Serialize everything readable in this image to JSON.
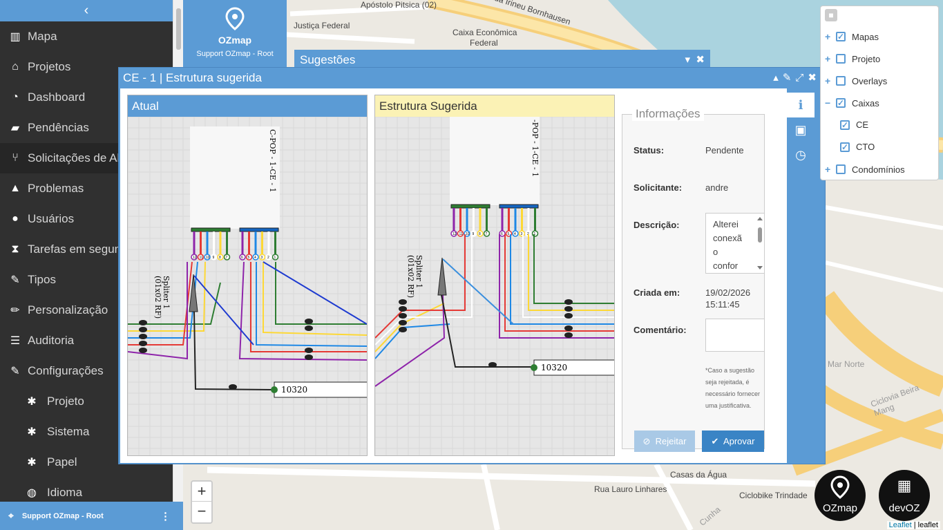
{
  "sidebar": {
    "collapse_icon": "chevron-left-icon",
    "items": [
      {
        "label": "Mapa",
        "icon": "map-icon"
      },
      {
        "label": "Projetos",
        "icon": "home-icon"
      },
      {
        "label": "Dashboard",
        "icon": "pie-chart-icon"
      },
      {
        "label": "Pendências",
        "icon": "truck-icon"
      },
      {
        "label": "Solicitações de Alt",
        "icon": "merge-icon"
      },
      {
        "label": "Problemas",
        "icon": "warning-icon"
      },
      {
        "label": "Usuários",
        "icon": "user-icon"
      },
      {
        "label": "Tarefas em segund",
        "icon": "hourglass-icon"
      },
      {
        "label": "Tipos",
        "icon": "wrench-icon"
      },
      {
        "label": "Personalização",
        "icon": "pencil-icon"
      },
      {
        "label": "Auditoria",
        "icon": "list-icon"
      },
      {
        "label": "Configurações",
        "icon": "wrench-icon"
      }
    ],
    "subitems": [
      {
        "label": "Projeto",
        "icon": "gear-icon"
      },
      {
        "label": "Sistema",
        "icon": "gear-icon"
      },
      {
        "label": "Papel",
        "icon": "gear-icon"
      },
      {
        "label": "Idioma",
        "icon": "globe-icon"
      }
    ],
    "user": "Support OZmap - Root"
  },
  "brand": {
    "logo_text": "OZmap",
    "user": "Support OZmap - Root"
  },
  "map_labels": [
    "Apóstolo Pitsica (02)",
    "Justiça Federal",
    "Caixa Econômica",
    "Federal",
    "Rua Irineu Bornhausen",
    "Mar Norte",
    "Ciclovia Beira Mang",
    "Casas da Água",
    "Rua Lauro Linhares",
    "Ciclobike Trindade",
    "Cunha"
  ],
  "sugestoes": {
    "title": "Sugestões"
  },
  "modal": {
    "title": "CE - 1 | Estrutura sugerida",
    "panel_atual": "Atual",
    "panel_sugerida": "Estrutura Sugerida",
    "box_label": "C-POP - 1-CE - 1",
    "box_label_cut": "-POP - 1-CE - 1",
    "splitter": "Spliter 1",
    "splitter_ratio": "(01x02 RF)",
    "cable_id": "10320",
    "ports_left": [
      "12",
      "11",
      "10",
      "9",
      "8",
      "7"
    ],
    "ports_right": [
      "6",
      "5",
      "4",
      "3",
      "2",
      "1"
    ]
  },
  "info": {
    "legend": "Informações",
    "status_label": "Status:",
    "status_value": "Pendente",
    "requester_label": "Solicitante:",
    "requester_value": "andre",
    "description_label": "Descrição:",
    "description_lines": [
      "Alterei",
      "conexã",
      "o",
      "confor"
    ],
    "created_label": "Criada em:",
    "created_date": "19/02/2026",
    "created_time": "15:11:45",
    "comment_label": "Comentário:",
    "note": "*Caso a sugestão seja rejeitada, é necessário fornecer uma justificativa.",
    "reject_label": "Rejeitar",
    "approve_label": "Aprovar"
  },
  "layers": [
    {
      "label": "Mapas",
      "checked": true,
      "toggle": "+"
    },
    {
      "label": "Projeto",
      "checked": false,
      "toggle": "+"
    },
    {
      "label": "Overlays",
      "checked": false,
      "toggle": "+"
    },
    {
      "label": "Caixas",
      "checked": true,
      "toggle": "−"
    },
    {
      "label": "CE",
      "checked": true,
      "toggle": ""
    },
    {
      "label": "CTO",
      "checked": true,
      "toggle": ""
    },
    {
      "label": "Condomínios",
      "checked": false,
      "toggle": "+"
    }
  ],
  "badges": [
    {
      "text": "OZmap"
    },
    {
      "text": "devOZ"
    }
  ],
  "attribution": {
    "leaflet": "Leaflet",
    "rest": "| leaflet"
  },
  "zoom": {
    "in": "+",
    "out": "−"
  },
  "colors": {
    "accent": "#5b9bd5",
    "sidebar": "#303030",
    "suggest": "#fbf2b5"
  }
}
